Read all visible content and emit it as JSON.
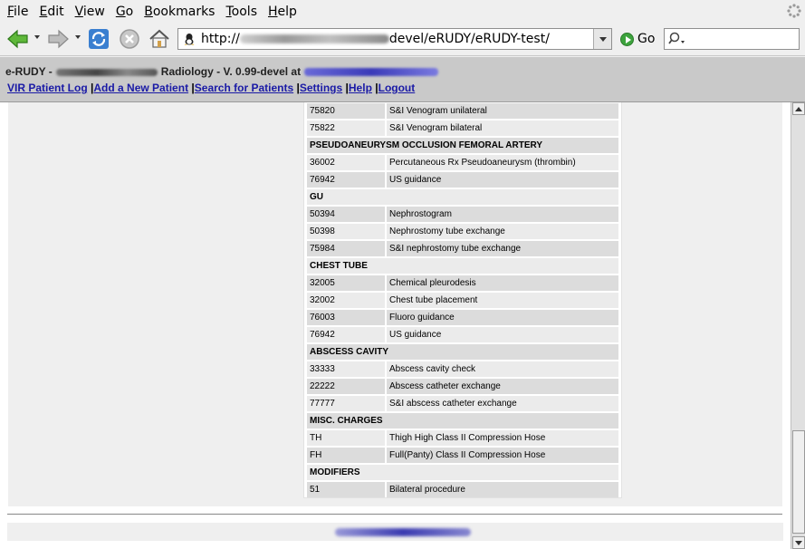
{
  "menu": [
    "File",
    "Edit",
    "View",
    "Go",
    "Bookmarks",
    "Tools",
    "Help"
  ],
  "menu_underline": [
    "F",
    "E",
    "V",
    "G",
    "B",
    "T",
    "H"
  ],
  "url": {
    "prefix": "http://",
    "suffix": "devel/eRUDY/eRUDY-test/"
  },
  "go_label": "Go",
  "app": {
    "title_prefix": "e-RUDY -",
    "title_middle": "Radiology - V. 0.99-devel at",
    "links": [
      "VIR Patient Log",
      "Add a New Patient",
      "Search for Patients",
      "Settings",
      "Help",
      "Logout"
    ]
  },
  "rows": [
    {
      "type": "item",
      "code": "75820",
      "desc": "S&I Venogram unilateral"
    },
    {
      "type": "item",
      "code": "75822",
      "desc": "S&I Venogram bilateral"
    },
    {
      "type": "header",
      "label": "PSEUDOANEURYSM OCCLUSION FEMORAL ARTERY"
    },
    {
      "type": "item",
      "code": "36002",
      "desc": "Percutaneous Rx Pseudoaneurysm (thrombin)"
    },
    {
      "type": "item",
      "code": "76942",
      "desc": "US guidance"
    },
    {
      "type": "header",
      "label": "GU"
    },
    {
      "type": "item",
      "code": "50394",
      "desc": "Nephrostogram"
    },
    {
      "type": "item",
      "code": "50398",
      "desc": "Nephrostomy tube exchange"
    },
    {
      "type": "item",
      "code": "75984",
      "desc": "S&I nephrostomy tube exchange"
    },
    {
      "type": "header",
      "label": "CHEST TUBE"
    },
    {
      "type": "item",
      "code": "32005",
      "desc": "Chemical pleurodesis"
    },
    {
      "type": "item",
      "code": "32002",
      "desc": "Chest tube placement"
    },
    {
      "type": "item",
      "code": "76003",
      "desc": "Fluoro guidance"
    },
    {
      "type": "item",
      "code": "76942",
      "desc": "US guidance"
    },
    {
      "type": "header",
      "label": "ABSCESS CAVITY"
    },
    {
      "type": "item",
      "code": "33333",
      "desc": "Abscess cavity check"
    },
    {
      "type": "item",
      "code": "22222",
      "desc": "Abscess catheter exchange"
    },
    {
      "type": "item",
      "code": "77777",
      "desc": "S&I abscess catheter exchange"
    },
    {
      "type": "header",
      "label": "MISC. CHARGES"
    },
    {
      "type": "item",
      "code": "TH",
      "desc": "Thigh High Class II Compression Hose"
    },
    {
      "type": "item",
      "code": "FH",
      "desc": "Full(Panty) Class II Compression Hose"
    },
    {
      "type": "header",
      "label": "MODIFIERS"
    },
    {
      "type": "item",
      "code": "51",
      "desc": "Bilateral procedure"
    }
  ]
}
